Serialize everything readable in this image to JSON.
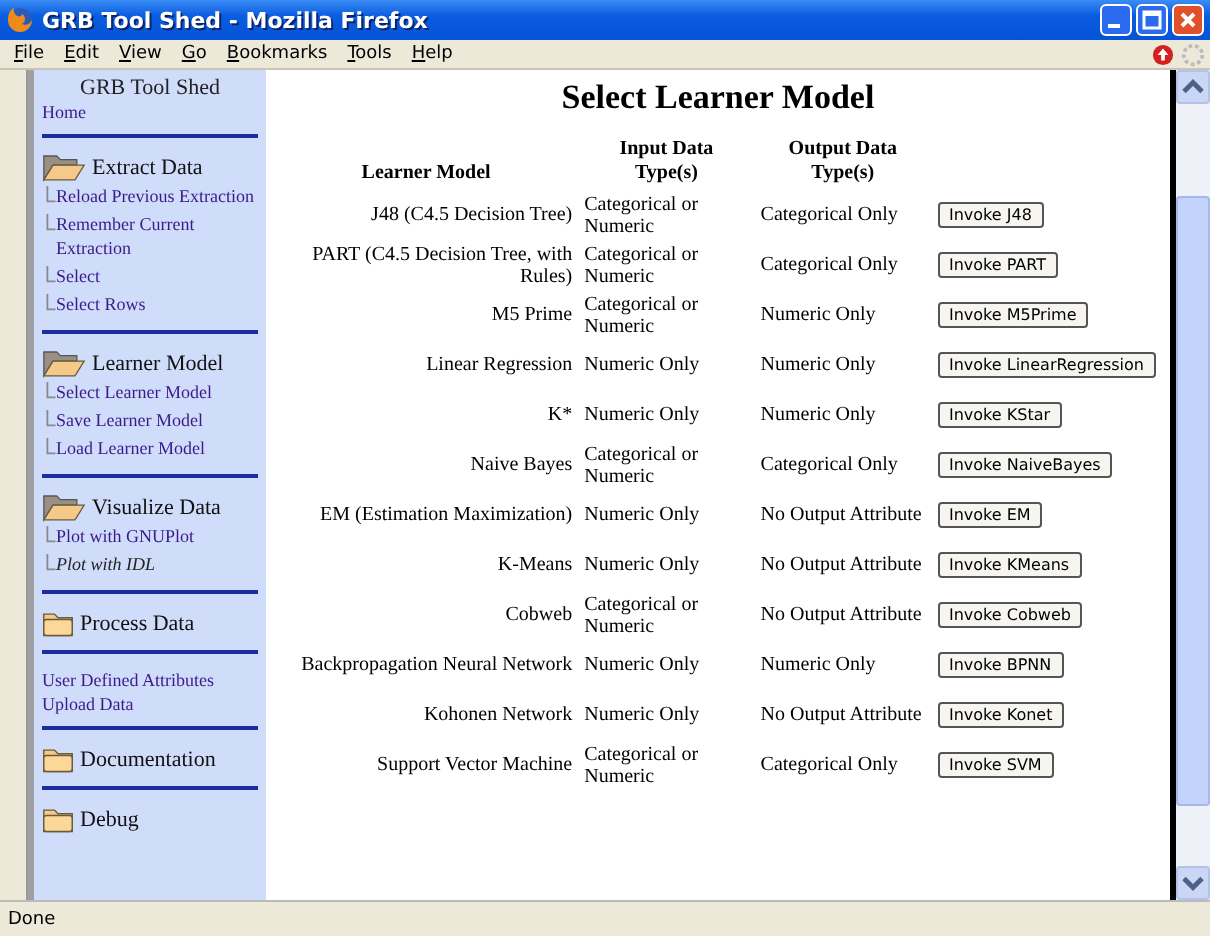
{
  "window": {
    "title": "GRB Tool Shed - Mozilla Firefox"
  },
  "menu": [
    {
      "label": "File"
    },
    {
      "label": "Edit"
    },
    {
      "label": "View"
    },
    {
      "label": "Go"
    },
    {
      "label": "Bookmarks"
    },
    {
      "label": "Tools"
    },
    {
      "label": "Help"
    }
  ],
  "sidebar": {
    "title": "GRB Tool Shed",
    "home": "Home",
    "sections": [
      {
        "kind": "folder",
        "label": "Extract Data",
        "expanded": true,
        "items": [
          {
            "label": "Reload Previous Extraction",
            "disabled": false
          },
          {
            "label": "Remember Current Extraction",
            "disabled": false
          },
          {
            "label": "Select",
            "disabled": false
          },
          {
            "label": "Select Rows",
            "disabled": false
          }
        ]
      },
      {
        "kind": "folder",
        "label": "Learner Model",
        "expanded": true,
        "items": [
          {
            "label": "Select Learner Model",
            "disabled": false
          },
          {
            "label": "Save Learner Model",
            "disabled": false
          },
          {
            "label": "Load Learner Model",
            "disabled": false
          }
        ]
      },
      {
        "kind": "folder",
        "label": "Visualize Data",
        "expanded": true,
        "items": [
          {
            "label": "Plot with GNUPlot",
            "disabled": false
          },
          {
            "label": "Plot with IDL",
            "disabled": true
          }
        ]
      },
      {
        "kind": "folder",
        "label": "Process Data",
        "expanded": false
      },
      {
        "kind": "links",
        "items": [
          {
            "label": "User Defined Attributes",
            "disabled": false
          },
          {
            "label": "Upload Data",
            "disabled": false
          }
        ]
      },
      {
        "kind": "folder",
        "label": "Documentation",
        "expanded": false
      },
      {
        "kind": "folder",
        "label": "Debug",
        "expanded": false
      }
    ]
  },
  "page": {
    "heading": "Select Learner Model",
    "table": {
      "columns": [
        "Learner Model",
        "Input Data Type(s)",
        "Output Data Type(s)"
      ],
      "rows": [
        {
          "model": "J48 (C4.5 Decision Tree)",
          "input": "Categorical or Numeric",
          "output": "Categorical Only",
          "button": "Invoke J48"
        },
        {
          "model": "PART (C4.5 Decision Tree, with Rules)",
          "input": "Categorical or Numeric",
          "output": "Categorical Only",
          "button": "Invoke PART"
        },
        {
          "model": "M5 Prime",
          "input": "Categorical or Numeric",
          "output": "Numeric Only",
          "button": "Invoke M5Prime"
        },
        {
          "model": "Linear Regression",
          "input": "Numeric Only",
          "output": "Numeric Only",
          "button": "Invoke LinearRegression"
        },
        {
          "model": "K*",
          "input": "Numeric Only",
          "output": "Numeric Only",
          "button": "Invoke KStar"
        },
        {
          "model": "Naive Bayes",
          "input": "Categorical or Numeric",
          "output": "Categorical Only",
          "button": "Invoke NaiveBayes"
        },
        {
          "model": "EM (Estimation Maximization)",
          "input": "Numeric Only",
          "output": "No Output Attribute",
          "button": "Invoke EM"
        },
        {
          "model": "K-Means",
          "input": "Numeric Only",
          "output": "No Output Attribute",
          "button": "Invoke KMeans"
        },
        {
          "model": "Cobweb",
          "input": "Categorical or Numeric",
          "output": "No Output Attribute",
          "button": "Invoke Cobweb"
        },
        {
          "model": "Backpropagation Neural Network",
          "input": "Numeric Only",
          "output": "Numeric Only",
          "button": "Invoke BPNN"
        },
        {
          "model": "Kohonen Network",
          "input": "Numeric Only",
          "output": "No Output Attribute",
          "button": "Invoke Konet"
        },
        {
          "model": "Support Vector Machine",
          "input": "Categorical or Numeric",
          "output": "Categorical Only",
          "button": "Invoke SVM"
        }
      ]
    }
  },
  "status_bar": {
    "text": "Done"
  }
}
